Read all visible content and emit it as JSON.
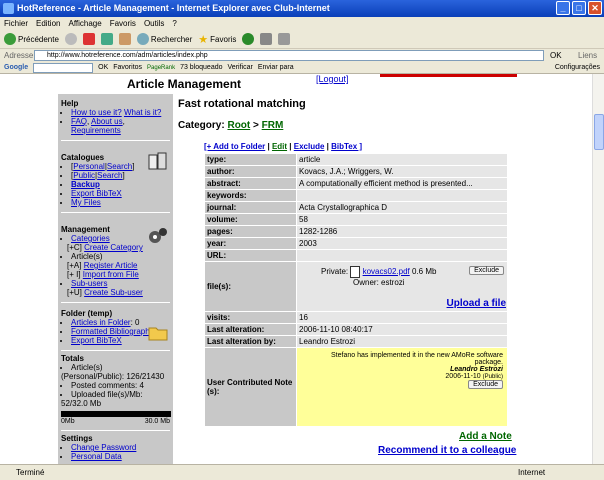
{
  "window": {
    "title": "HotReference - Article Management - Internet Explorer avec Club-Internet"
  },
  "menu": [
    "Fichier",
    "Edition",
    "Affichage",
    "Favoris",
    "Outils",
    "?"
  ],
  "toolbar": {
    "back": "Précédente",
    "search": "Rechercher",
    "favorites": "Favoris"
  },
  "address": {
    "label": "Adresse",
    "url": "http://www.hotreference.com/adm/articles/index.php",
    "go": "OK",
    "links": "Liens"
  },
  "googlebar": {
    "label": "Google",
    "go": "OK",
    "favoritos": "Favoritos",
    "blocked": "73 bloqueado",
    "verify": "Verificar",
    "send": "Enviar para",
    "settings": "Configurações",
    "pagerank": "PageRank"
  },
  "page": {
    "title": "Article Management",
    "logout": "[Logout]"
  },
  "sidebar": {
    "help": {
      "title": "Help",
      "links": [
        "How to use it?",
        "What is it?",
        "FAQ",
        "About us",
        "Requirements"
      ]
    },
    "catalogues": {
      "title": "Catalogues",
      "personal": "Personal",
      "public": "Public",
      "search": "Search",
      "backup": "Backup",
      "export": "Export BibTeX",
      "files": "My Files"
    },
    "management": {
      "title": "Management",
      "categories": "Categories",
      "create_cat_key": "[+C]",
      "create_cat": "Create Category",
      "articles": "Article(s)",
      "reg_key": "[+A]",
      "reg": "Register Article",
      "import_key": "[+ I]",
      "import": "Import from File",
      "subusers": "Sub-users",
      "create_sub_key": "[+U]",
      "create_sub": "Create Sub-user"
    },
    "folder": {
      "title": "Folder (temp)",
      "in_folder": "Articles in Folder",
      "count": "0",
      "formatted": "Formatted Bibliography",
      "export": "Export BibTeX"
    },
    "totals": {
      "title": "Totals",
      "articles": "Article(s)",
      "articles_detail": "(Personal/Public): 126/21430",
      "comments": "Posted comments: 4",
      "uploaded": "Uploaded file(s)/Mb:",
      "uploaded_val": "52/32.0 Mb",
      "min": "0Mb",
      "max": "30.0 Mb"
    },
    "settings": {
      "title": "Settings",
      "change_pw": "Change Password",
      "personal_data": "Personal Data"
    }
  },
  "main": {
    "heading": "Fast rotational matching",
    "category_label": "Category:",
    "cat_root": "Root",
    "cat_sep": ">",
    "cat_frm": "FRM",
    "actions": {
      "add": "[+ Add to Folder",
      "edit": "Edit",
      "exclude": "Exclude",
      "bibtex": "BibTex ]"
    },
    "props": [
      {
        "k": "type:",
        "v": "article"
      },
      {
        "k": "author:",
        "v": "Kovacs, J.A.; Wriggers, W."
      },
      {
        "k": "abstract:",
        "v": "A computationally efficient method is presented..."
      },
      {
        "k": "keywords:",
        "v": ""
      },
      {
        "k": "journal:",
        "v": "Acta Crystallographica D"
      },
      {
        "k": "volume:",
        "v": "58"
      },
      {
        "k": "pages:",
        "v": "1282-1286"
      },
      {
        "k": "year:",
        "v": "2003"
      },
      {
        "k": "URL:",
        "v": ""
      }
    ],
    "files": {
      "label": "file(s):",
      "private": "Private:",
      "filename": "kovacs02.pdf",
      "size": "0.6 Mb",
      "owner": "Owner: estrozi",
      "exclude": "Exclude",
      "upload": "Upload a file"
    },
    "props2": [
      {
        "k": "visits:",
        "v": "16"
      },
      {
        "k": "Last alteration:",
        "v": "2006-11-10 08:40:17"
      },
      {
        "k": "Last alteration by:",
        "v": "Leandro Estrozi"
      }
    ],
    "note": {
      "label": "User Contributed Note (s):",
      "text": "Stefano has implemented it in the new AMoRe software package.",
      "author": "Leandro Estrozi",
      "date": "2006-11-10",
      "visibility": "(Public)",
      "exclude": "Exclude"
    },
    "add_note": "Add a Note",
    "recommend": "Recommend it to a colleague"
  },
  "status": {
    "text": "Terminé",
    "zone": "Internet"
  }
}
